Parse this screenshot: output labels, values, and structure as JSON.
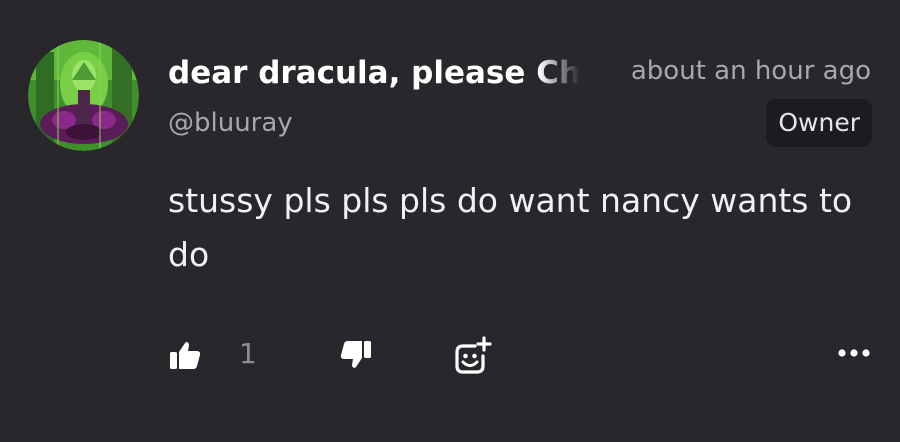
{
  "comment": {
    "author_name": "dear dracula, please Ch",
    "handle": "@bluuray",
    "timestamp": "about an hour ago",
    "badge": "Owner",
    "text": "stussy pls pls pls do want nancy wants to do",
    "like_count": "1"
  },
  "icons": {
    "like": "thumbs-up-icon",
    "dislike": "thumbs-down-icon",
    "react": "add-reaction-icon",
    "more": "more-dots-icon"
  },
  "colors": {
    "background": "#29262c",
    "primary_text": "#ffffff",
    "secondary_text": "#a9a6ad",
    "badge_background": "#1d1b20"
  }
}
